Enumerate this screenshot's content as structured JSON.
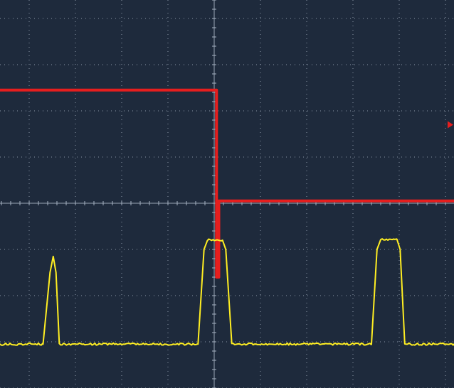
{
  "chart_data": {
    "type": "line",
    "title": "",
    "xlabel": "",
    "ylabel": "",
    "xlim": [
      -5,
      5.6
    ],
    "ylim": [
      -4.2,
      4.6
    ],
    "grid": true,
    "grid_divisions": {
      "x": 10,
      "y": 8
    },
    "background_color": "#1e2a3c",
    "grid_color": "#a8b4c4",
    "series": [
      {
        "color": "#e61e1e",
        "style": "step",
        "points": [
          [
            -5,
            2.45
          ],
          [
            0.05,
            2.45
          ],
          [
            0.05,
            -1.6
          ],
          [
            0.1,
            -1.6
          ],
          [
            0.1,
            0.05
          ],
          [
            5.6,
            0.05
          ]
        ]
      },
      {
        "color": "#ffee22",
        "style": "pulse-train",
        "baseline": -3.05,
        "points": [
          [
            -5,
            -3.05
          ],
          [
            -3.7,
            -3.05
          ],
          [
            -3.55,
            -1.5
          ],
          [
            -3.48,
            -1.15
          ],
          [
            -3.42,
            -1.5
          ],
          [
            -3.35,
            -3.05
          ],
          [
            -0.35,
            -3.05
          ],
          [
            -0.22,
            -1.0
          ],
          [
            -0.15,
            -0.8
          ],
          [
            0.18,
            -0.8
          ],
          [
            0.25,
            -1.0
          ],
          [
            0.38,
            -3.05
          ],
          [
            3.4,
            -3.05
          ],
          [
            3.52,
            -1.0
          ],
          [
            3.6,
            -0.78
          ],
          [
            3.95,
            -0.78
          ],
          [
            4.02,
            -1.0
          ],
          [
            4.12,
            -3.05
          ],
          [
            5.6,
            -3.05
          ]
        ]
      }
    ],
    "trigger_marker": {
      "color": "#e61e1e",
      "y": 1.7
    }
  }
}
